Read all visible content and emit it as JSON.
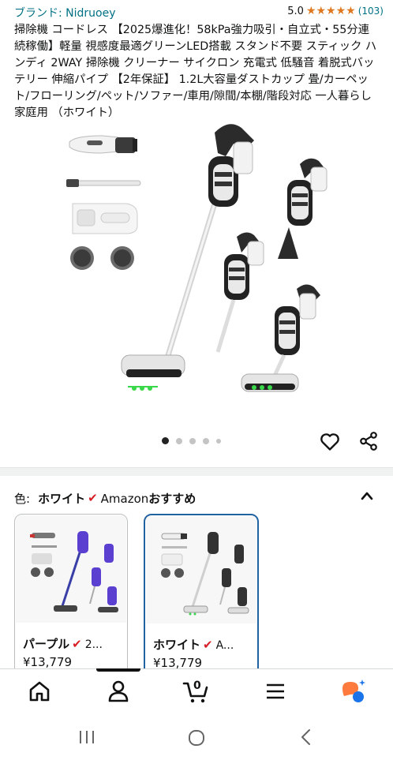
{
  "product": {
    "brand_text": "ブランド: Nidruoey",
    "rating_value": "5.0",
    "stars": "★★★★★",
    "rating_count": "(103)",
    "title": "掃除機 コードレス 【2025爆進化！58kPa強力吸引・自立式・55分連続稼働】軽量 視感度最適グリーンLED搭載 スタンド不要 スティック ハンディ 2WAY 掃除機 クリーナー サイクロン 充電式 低騒音 着脱式バッテリー 伸縮パイプ 【2年保証】 1.2L大容量ダストカップ 畳/カーペット/フローリング/ペット/ソファー/車用/隙間/本棚/階段対応 一人暮らし 家庭用 （ホワイト）"
  },
  "gallery": {
    "dot_count": 5,
    "active_index": 0
  },
  "color_selector": {
    "label": "色:",
    "selected": "ホワイト",
    "check": "✔",
    "badge_prefix": "Amazon",
    "badge_suffix": "おすすめ"
  },
  "swatches": [
    {
      "name": "パープル",
      "check": "✔",
      "meta": "2...",
      "price": "¥13,779",
      "accent": "#5b3fd1"
    },
    {
      "name": "ホワイト",
      "check": "✔",
      "meta": "A...",
      "price": "¥13,779",
      "accent": "#2162a1"
    }
  ],
  "bottom_nav": {
    "cart_count": "0"
  },
  "colors": {
    "link": "#007185",
    "star": "#de7921",
    "check": "#d61f26",
    "selected_border": "#2162a1",
    "led_green": "#38d84a",
    "rufus_orange": "#ff7a3d",
    "rufus_blue": "#1a73e8"
  },
  "icons": [
    "heart-icon",
    "share-icon",
    "chevron-up-icon",
    "home-icon",
    "account-icon",
    "cart-icon",
    "menu-icon",
    "rufus-icon",
    "recent-apps-icon",
    "home-circle-icon",
    "back-icon"
  ]
}
